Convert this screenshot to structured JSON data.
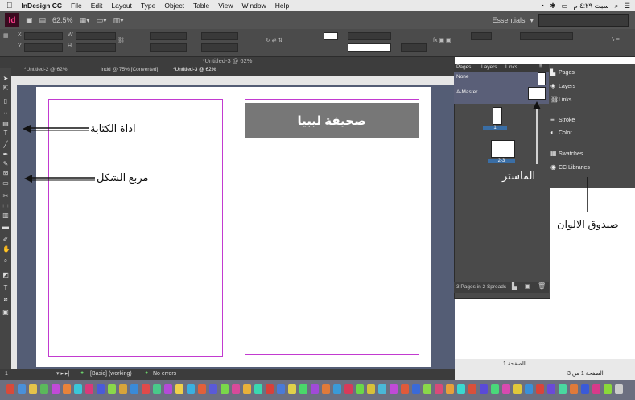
{
  "menubar": {
    "apple": "",
    "app_name": "InDesign CC",
    "items": [
      "File",
      "Edit",
      "Layout",
      "Type",
      "Object",
      "Table",
      "View",
      "Window",
      "Help"
    ],
    "right_text": "سبت ٤:٢٩ م"
  },
  "appbar": {
    "logo": "Id",
    "zoom": "62.5%",
    "workspace": "Essentials"
  },
  "document": {
    "window_title": "*Untitled-3 @ 62%",
    "tabs": [
      "*Untitled-2 @ 62%",
      "Indd @ 75% [Converted]",
      "*Untitled-3 @ 62%"
    ]
  },
  "page": {
    "title_box_text": "صحيفة ليبيا"
  },
  "annotations": {
    "type_tool": "اداة الكتابة",
    "rect_frame": "مربع الشكل",
    "master": "الماستر",
    "swatches": "صندوق الالوان"
  },
  "pages_panel": {
    "tabs": [
      "Pages",
      "Layers",
      "Links"
    ],
    "master_none": "None",
    "master_a": "A-Master",
    "page1_label": "1",
    "page23_label": "2-3",
    "footer": "3 Pages in 2 Spreads"
  },
  "side_panels": {
    "items": [
      "Pages",
      "Layers",
      "Links",
      "Stroke",
      "Color",
      "Swatches",
      "CC Libraries"
    ]
  },
  "status": {
    "page_field": "1",
    "preflight": "[Basic] (working)",
    "errors": "No errors"
  },
  "arabic_info": {
    "line1": "الصفحة 1",
    "line2": "الصفحة 1 من 3"
  },
  "colors": {
    "magenta_margin": "#c23ad0",
    "title_box_bg": "#777777",
    "pasteboard": "#545d75",
    "app_logo": "#ff3d8b"
  }
}
